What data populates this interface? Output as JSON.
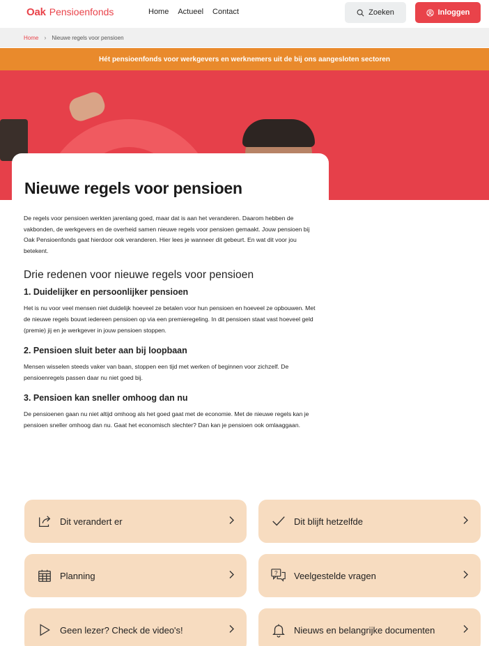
{
  "header": {
    "logo_mark": "Oak",
    "logo_name": "Pensioenfonds",
    "nav": [
      "Home",
      "Actueel",
      "Contact"
    ],
    "search_label": "Zoeken",
    "login_label": "Inloggen"
  },
  "breadcrumb": {
    "home": "Home",
    "current": "Nieuwe regels voor pensioen"
  },
  "banner": "Hét pensioenfonds voor werkgevers en werknemers uit de bij ons aangesloten sectoren",
  "page": {
    "title": "Nieuwe regels voor pensioen",
    "intro": "De regels voor pensioen werkten jarenlang goed, maar dat is aan het veranderen. Daarom hebben de vakbonden, de werkgevers en de overheid samen nieuwe regels voor pensioen gemaakt. Jouw pensioen bij Oak Pensioenfonds gaat hierdoor ook veranderen. Hier lees je wanneer dit gebeurt. En wat dit voor jou betekent.",
    "reasons_heading": "Drie redenen voor nieuwe regels voor pensioen",
    "reasons": [
      {
        "title": "1. Duidelijker en persoonlijker pensioen",
        "text": "Het is nu voor veel mensen niet duidelijk hoeveel ze betalen voor hun pensioen en hoeveel ze opbouwen. Met de nieuwe regels bouwt iedereen pensioen op via een premieregeling. In dit pensioen staat vast hoeveel geld (premie) jij en je werkgever in jouw pensioen stoppen."
      },
      {
        "title": "2. Pensioen sluit beter aan bij loopbaan",
        "text": "Mensen wisselen steeds vaker van baan, stoppen een tijd met werken of beginnen voor zichzelf. De pensioenregels passen daar nu niet goed bij."
      },
      {
        "title": "3. Pensioen kan sneller omhoog dan nu",
        "text": "De pensioenen gaan nu niet altijd omhoog als het goed gaat met de economie. Met de nieuwe regels kan je pensioen sneller omhoog dan nu. Gaat het economisch slechter? Dan kan je pensioen ook omlaaggaan."
      }
    ]
  },
  "tiles": [
    {
      "label": "Dit verandert er",
      "icon": "share-icon"
    },
    {
      "label": "Dit blijft hetzelfde",
      "icon": "checkmark-icon"
    },
    {
      "label": "Planning",
      "icon": "calendar-icon"
    },
    {
      "label": "Veelgestelde vragen",
      "icon": "question-chat-icon"
    },
    {
      "label": "Geen lezer? Check de video's!",
      "icon": "play-icon"
    },
    {
      "label": "Nieuws en belangrijke documenten",
      "icon": "bell-icon"
    }
  ],
  "colors": {
    "brand_red": "#e9434a",
    "banner_orange": "#e98a2c",
    "tile_peach": "#f7dcc0"
  }
}
